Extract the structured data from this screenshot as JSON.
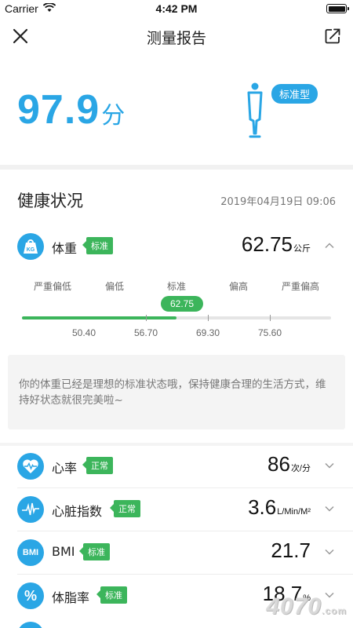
{
  "status_bar": {
    "carrier": "Carrier",
    "time": "4:42 PM"
  },
  "nav": {
    "title": "测量报告",
    "close_icon": "close-icon",
    "share_icon": "share-icon"
  },
  "score": {
    "value": "97.9",
    "unit": "分",
    "body_type": "标准型"
  },
  "section": {
    "title": "健康状况",
    "date": "2019年04月19日 09:06"
  },
  "weight": {
    "name": "体重",
    "badge": "标准",
    "value": "62.75",
    "unit": "公斤",
    "icon_text": "KG",
    "range_labels": [
      "严重偏低",
      "偏低",
      "标准",
      "偏高",
      "严重偏高"
    ],
    "current": "62.75",
    "current_fraction": 0.5,
    "thresholds": [
      "50.40",
      "56.70",
      "69.30",
      "75.60"
    ],
    "advice": "你的体重已经是理想的标准状态哦，保持健康合理的生活方式，维持好状态就很完美啦~"
  },
  "metrics": [
    {
      "name": "心率",
      "badge": "正常",
      "value": "86",
      "unit": "次/分",
      "icon": "heart-rate-icon"
    },
    {
      "name": "心脏指数",
      "badge": "正常",
      "value": "3.6",
      "unit": "L/Min/M²",
      "icon": "cardiac-index-icon"
    },
    {
      "name": "BMI",
      "badge": "标准",
      "value": "21.7",
      "unit": "",
      "icon": "bmi-icon",
      "icon_text": "BMI"
    },
    {
      "name": "体脂率",
      "badge": "标准",
      "value": "18.7",
      "unit": "%",
      "icon": "percent-icon",
      "icon_text": "%"
    }
  ],
  "watermark": {
    "text": "4070",
    "suffix": ".com"
  },
  "colors": {
    "accent": "#2aa6e5",
    "ok_green": "#3cb55b"
  }
}
